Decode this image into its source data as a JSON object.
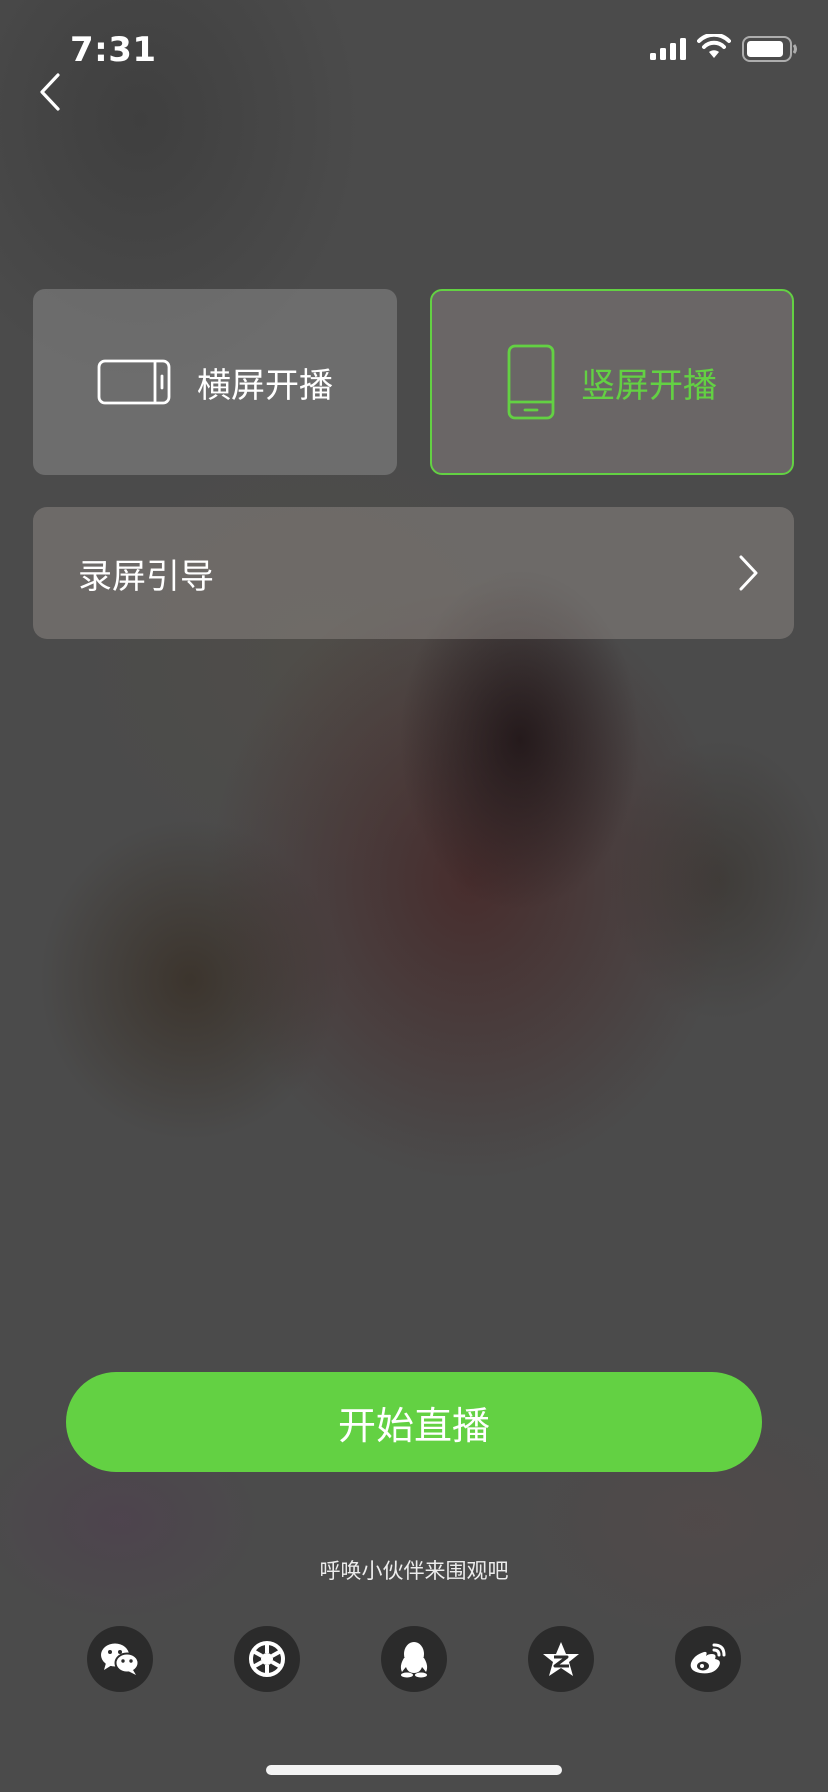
{
  "status_bar": {
    "time": "7:31",
    "icons": [
      "cellular-signal-icon",
      "wifi-icon",
      "battery-icon"
    ]
  },
  "navigation": {
    "back_icon": "chevron-left-icon"
  },
  "modes": {
    "landscape": {
      "label": "横屏开播",
      "icon": "landscape-phone-icon",
      "selected": false
    },
    "portrait": {
      "label": "竖屏开播",
      "icon": "portrait-phone-icon",
      "selected": true
    }
  },
  "guide": {
    "label": "录屏引导",
    "icon": "chevron-right-icon"
  },
  "start_button": {
    "label": "开始直播"
  },
  "invite": {
    "text": "呼唤小伙伴来围观吧"
  },
  "share": {
    "icons": [
      "wechat-icon",
      "moments-icon",
      "qq-icon",
      "qzone-icon",
      "weibo-icon"
    ]
  },
  "colors": {
    "accent": "#63d143",
    "card_bg": "rgba(150,150,150,0.45)",
    "share_bg": "#2b2b2b"
  }
}
